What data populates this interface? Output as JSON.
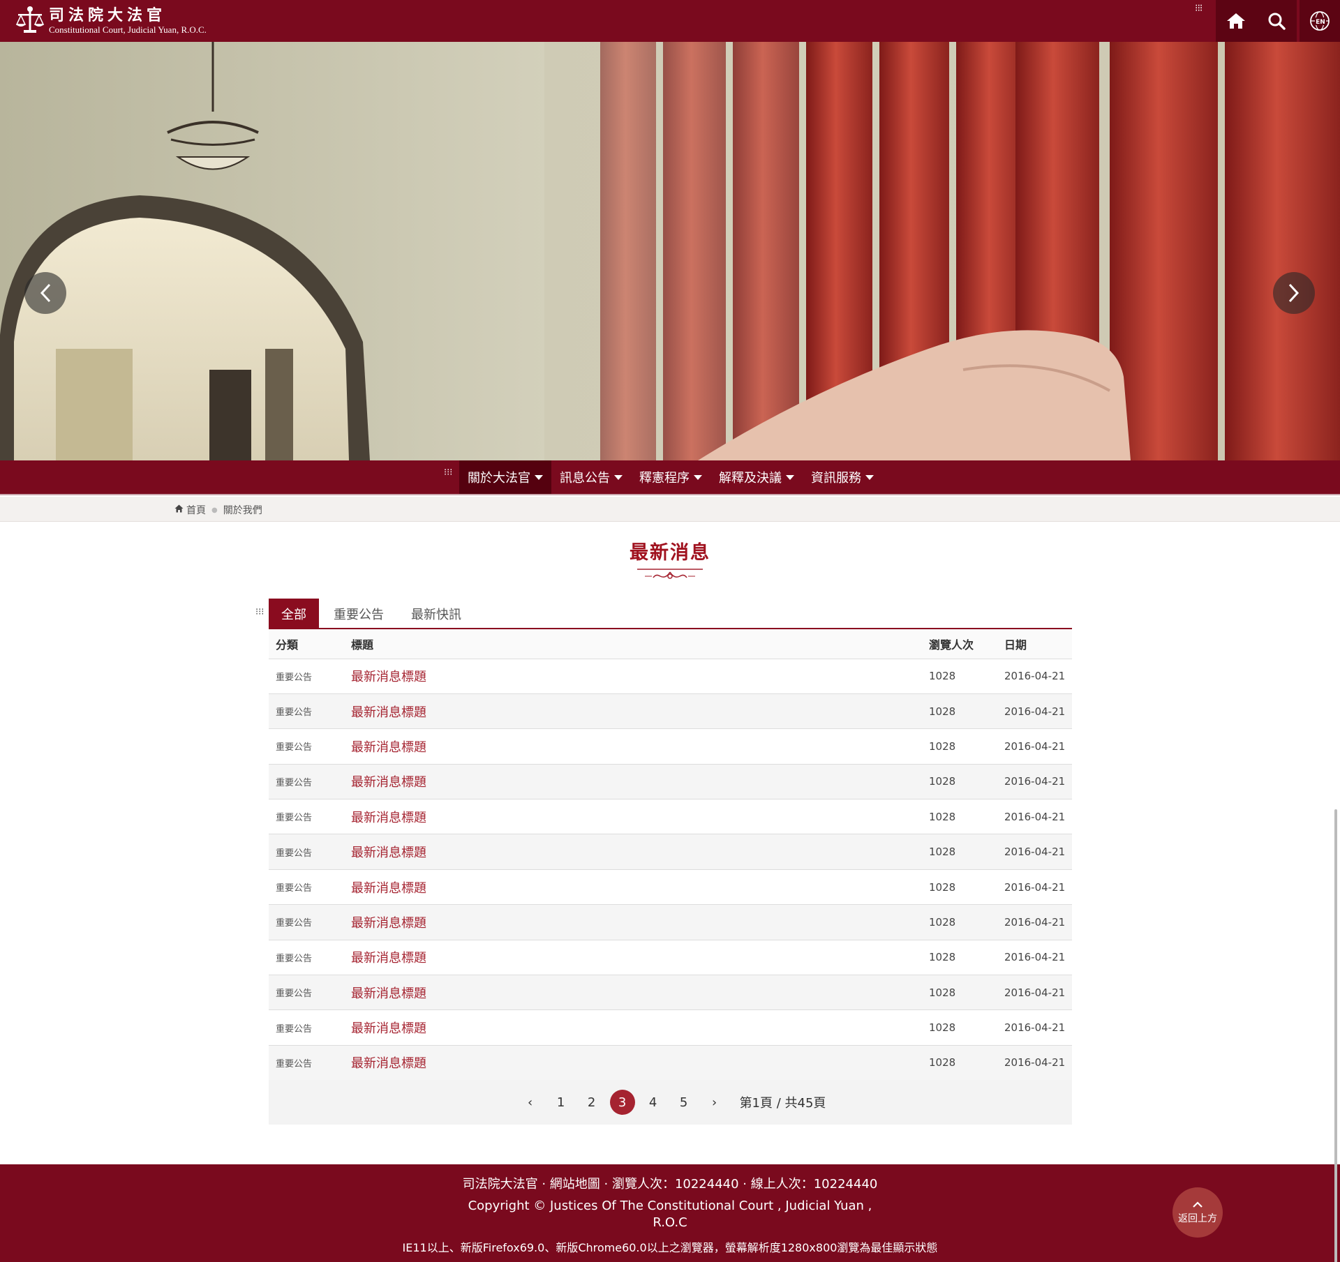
{
  "header": {
    "logo_title": "司法院大法官",
    "logo_subtitle": "Constitutional Court, Judicial Yuan, R.O.C.",
    "icons": [
      "menu-dots-icon",
      "home-icon",
      "search-icon",
      "globe-en-icon"
    ],
    "globe_label": "EN"
  },
  "nav": {
    "items": [
      {
        "label": "關於大法官"
      },
      {
        "label": "訊息公告"
      },
      {
        "label": "釋憲程序"
      },
      {
        "label": "解釋及決議"
      },
      {
        "label": "資訊服務"
      }
    ]
  },
  "breadcrumb": {
    "home": "首頁",
    "current": "關於我們"
  },
  "section": {
    "title": "最新消息"
  },
  "tabs": [
    "全部",
    "重要公告",
    "最新快訊"
  ],
  "table": {
    "headers": [
      "分類",
      "標題",
      "瀏覽人次",
      "日期"
    ],
    "rows": [
      {
        "category": "重要公告",
        "title": "最新消息標題",
        "views": "1028",
        "date": "2016-04-21"
      },
      {
        "category": "重要公告",
        "title": "最新消息標題",
        "views": "1028",
        "date": "2016-04-21"
      },
      {
        "category": "重要公告",
        "title": "最新消息標題",
        "views": "1028",
        "date": "2016-04-21"
      },
      {
        "category": "重要公告",
        "title": "最新消息標題",
        "views": "1028",
        "date": "2016-04-21"
      },
      {
        "category": "重要公告",
        "title": "最新消息標題",
        "views": "1028",
        "date": "2016-04-21"
      },
      {
        "category": "重要公告",
        "title": "最新消息標題",
        "views": "1028",
        "date": "2016-04-21"
      },
      {
        "category": "重要公告",
        "title": "最新消息標題",
        "views": "1028",
        "date": "2016-04-21"
      },
      {
        "category": "重要公告",
        "title": "最新消息標題",
        "views": "1028",
        "date": "2016-04-21"
      },
      {
        "category": "重要公告",
        "title": "最新消息標題",
        "views": "1028",
        "date": "2016-04-21"
      },
      {
        "category": "重要公告",
        "title": "最新消息標題",
        "views": "1028",
        "date": "2016-04-21"
      },
      {
        "category": "重要公告",
        "title": "最新消息標題",
        "views": "1028",
        "date": "2016-04-21"
      },
      {
        "category": "重要公告",
        "title": "最新消息標題",
        "views": "1028",
        "date": "2016-04-21"
      }
    ]
  },
  "pagination": {
    "prev": "‹",
    "pages": [
      "1",
      "2",
      "3",
      "4",
      "5"
    ],
    "current_page": "3",
    "next": "›",
    "info": "第1頁 / 共45頁"
  },
  "footer": {
    "links": "司法院大法官 · 網站地圖 · 瀏覽人次：10224440 · 線上人次：10224440",
    "copyright": "Copyright © Justices Of The Constitutional Court , Judicial Yuan , R.O.C",
    "browser_note": "IE11以上、新版Firefox69.0、新版Chrome60.0以上之瀏覽器，螢幕解析度1280x800瀏覽為最佳顯示狀態",
    "back_to_top": "返回上方"
  },
  "colors": {
    "brand": "#7a0a1e",
    "accent": "#a52330",
    "nav_active": "#55010f"
  }
}
